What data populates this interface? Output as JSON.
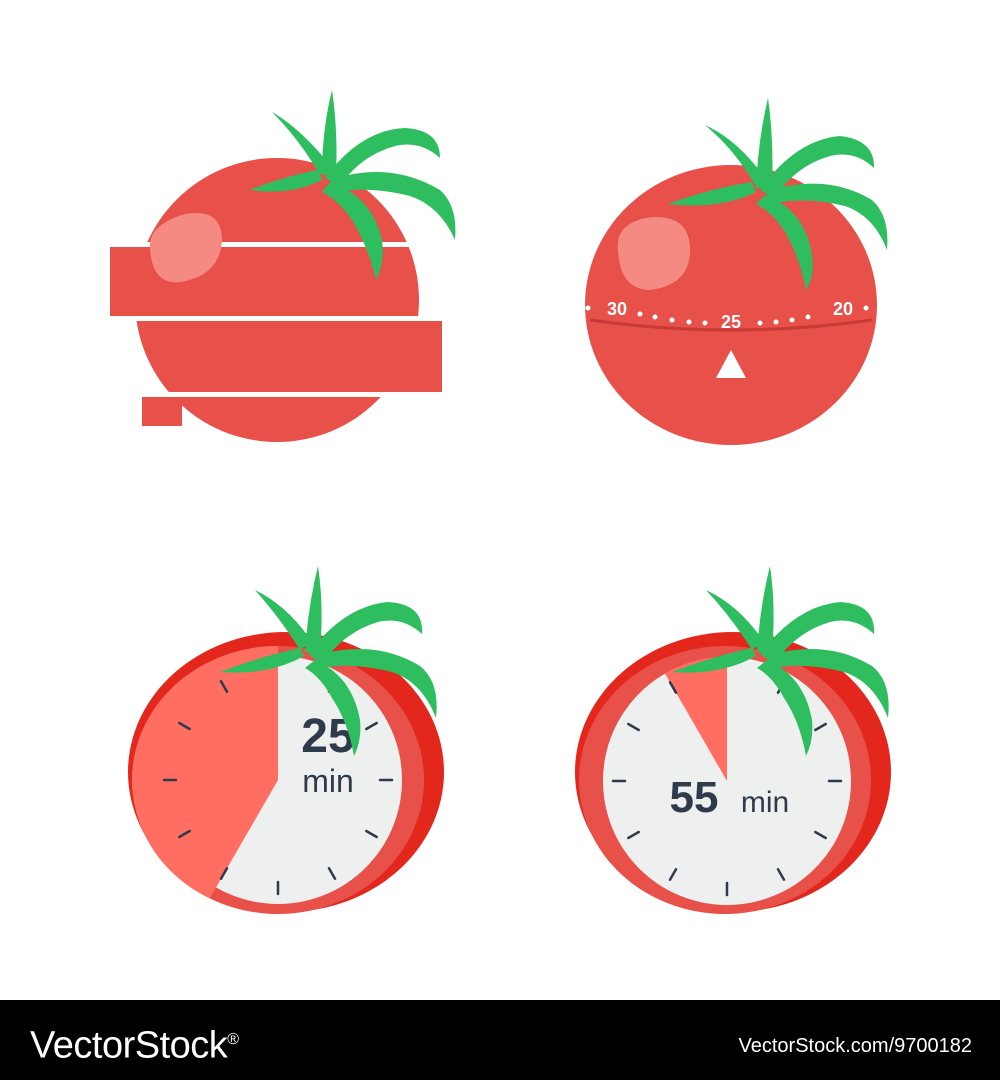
{
  "colors": {
    "tomato": "#e8504a",
    "tomato_light": "#ff6e61",
    "tomato_dark": "#e3271d",
    "highlight": "#f58a82",
    "leaf": "#2fbe5f",
    "dial_face": "#eef0f0",
    "dial_text": "#2f3a4a",
    "footer_bg": "#000000"
  },
  "icons": [
    {
      "name": "sliced-tomato-icon"
    },
    {
      "name": "kitchen-timer-tomato-icon",
      "scale_labels": [
        "30",
        "25",
        "20"
      ]
    },
    {
      "name": "tomato-clock-25-icon",
      "minutes": "25",
      "unit": "min",
      "elapsed_fraction": 0.4167
    },
    {
      "name": "tomato-clock-55-icon",
      "minutes": "55",
      "unit": "min",
      "elapsed_fraction": 0.0833
    }
  ],
  "footer": {
    "brand": "VectorStock",
    "registered": "®",
    "site": "VectorStock.com/9700182"
  }
}
